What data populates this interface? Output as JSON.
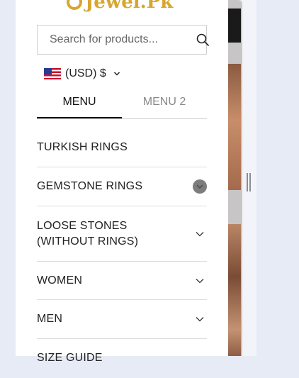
{
  "logo": {
    "text": "Jewel.Pk"
  },
  "search": {
    "placeholder": "Search for products..."
  },
  "currency": {
    "label": "(USD) $"
  },
  "tabs": [
    {
      "label": "MENU",
      "active": true
    },
    {
      "label": "MENU 2",
      "active": false
    }
  ],
  "menu": [
    {
      "label": "TURKISH RINGS",
      "has_children": false
    },
    {
      "label": "GEMSTONE RINGS",
      "has_children": true,
      "highlighted": true
    },
    {
      "label": "LOOSE STONES (WITHOUT RINGS)",
      "has_children": true
    },
    {
      "label": "WOMEN",
      "has_children": true
    },
    {
      "label": "MEN",
      "has_children": true
    },
    {
      "label": "SIZE GUIDE",
      "has_children": false
    }
  ],
  "icons": {
    "search": "search-icon",
    "chevron": "chevron-down-icon",
    "flag": "us-flag-icon"
  },
  "colors": {
    "logo": "#d6a62e",
    "toggle_bg": "#7d7d7d",
    "divider": "#dcdcdc"
  }
}
